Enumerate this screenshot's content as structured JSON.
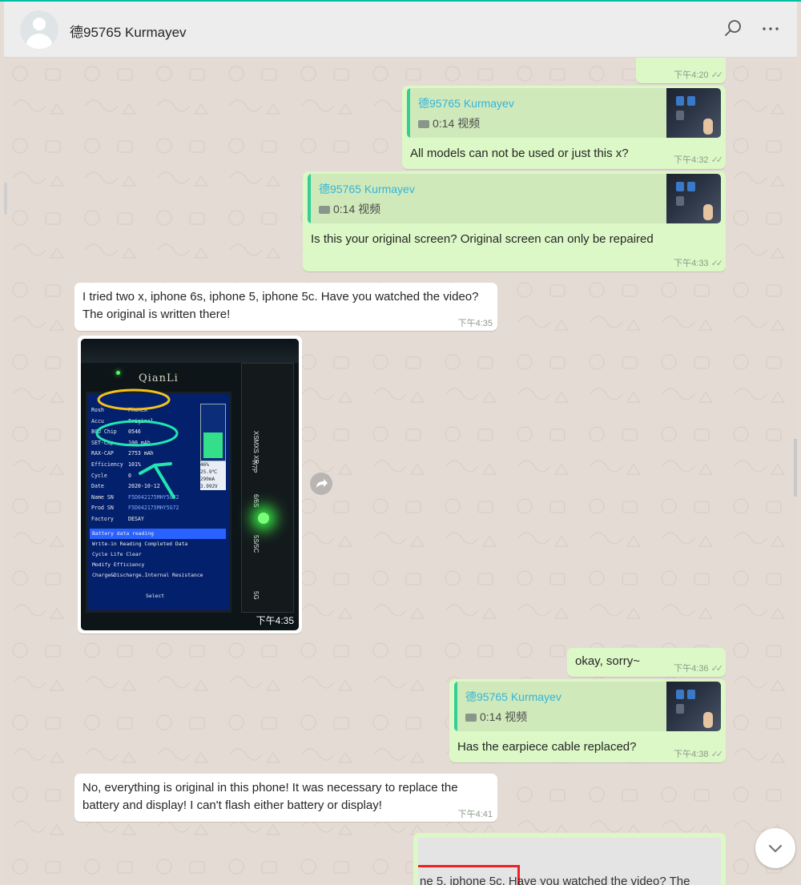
{
  "header": {
    "title": "德95765 Kurmayev",
    "search_icon": "search-icon",
    "menu_icon": "more-horizontal-icon"
  },
  "messages": {
    "m1": {
      "time": "下午4:20"
    },
    "m2": {
      "quote_name": "德95765 Kurmayev",
      "quote_caption": "0:14 视频",
      "text": "All models can not be used or just this x?",
      "time": "下午4:32"
    },
    "m3": {
      "quote_name": "德95765 Kurmayev",
      "quote_caption": "0:14 视频",
      "text": "Is this your original screen? Original screen can only be repaired",
      "time": "下午4:33"
    },
    "m4": {
      "text": "I tried two x, iphone 6s, iphone 5, iphone 5c. Have you watched the video? The original is written there!",
      "time": "下午4:35"
    },
    "m5": {
      "time": "下午4:35",
      "photo": {
        "brand": "QianLi",
        "screen_rows": [
          {
            "label": "Rosh",
            "value": "PhoneX"
          },
          {
            "label": "Accu",
            "value": "Original"
          },
          {
            "label": "BCU Chip",
            "value": "0546"
          },
          {
            "label": "SET-Cap",
            "value": "100 mAh"
          },
          {
            "label": "RAX-CAP",
            "value": "2753 mAh"
          },
          {
            "label": "Efficiency",
            "value": "101%"
          },
          {
            "label": "Cycle",
            "value": "0"
          },
          {
            "label": "Date",
            "value": "2020-10-12"
          },
          {
            "label": "Name SN",
            "value": "F5D042175MHY5G72"
          },
          {
            "label": "Prod SN",
            "value": "F5D042175MHY5G72"
          },
          {
            "label": "Factory",
            "value": "DESAY"
          }
        ],
        "menu_items": [
          "Battery data reading",
          "Write-in Reading Completed Data",
          "Cycle Life Clear",
          "Modify Efficiency",
          "Charge&Discharge.Internal Resistance"
        ],
        "select_label": "Select",
        "side_stats": [
          "46%",
          "25.9℃",
          "290mA",
          "3.992V"
        ],
        "board_labels": [
          "XSMXS XR",
          "7/7P",
          "6/6S",
          "5S/5C",
          "5G"
        ]
      }
    },
    "m6": {
      "text": "okay, sorry~",
      "time": "下午4:36"
    },
    "m7": {
      "quote_name": "德95765 Kurmayev",
      "quote_caption": "0:14 视频",
      "text": "Has the earpiece cable replaced?",
      "time": "下午4:38"
    },
    "m8": {
      "text": "No, everything is original in this phone! It was necessary to replace the battery and display! I can't flash either battery or display!",
      "time": "下午4:41"
    },
    "m9": {
      "text": "ne 5, iphone 5c. Have you watched the video? The"
    }
  },
  "icons": {
    "forward": "forward-icon",
    "scroll_down": "chevron-down-icon",
    "video": "video-camera-icon",
    "ticks": "read-ticks-icon"
  },
  "colors": {
    "outgoing": "#dcf8c6",
    "incoming": "#ffffff",
    "quote_name": "#35b4d8",
    "accent": "#00bfa5"
  }
}
